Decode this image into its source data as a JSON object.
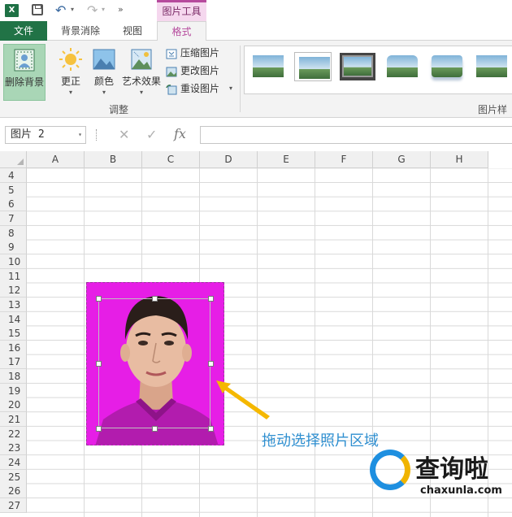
{
  "quick_access": {
    "app_icon": "X",
    "context_tools_label": "图片工具"
  },
  "tabs": {
    "file": "文件",
    "background_removal": "背景消除",
    "view": "视图",
    "format": "格式"
  },
  "ribbon": {
    "remove_background": "删除背景",
    "corrections": "更正",
    "color": "颜色",
    "artistic_effects": "艺术效果",
    "compress_pictures": "压缩图片",
    "change_picture": "更改图片",
    "reset_picture": "重设图片",
    "adjust_group_label": "调整",
    "picture_styles_label": "图片样"
  },
  "formula_bar": {
    "name_box": "图片 2",
    "cancel_symbol": "✕",
    "enter_symbol": "✓",
    "fx_symbol": "fx",
    "formula_value": ""
  },
  "sheet": {
    "columns": [
      "A",
      "B",
      "C",
      "D",
      "E",
      "F",
      "G",
      "H"
    ],
    "rows": [
      "4",
      "5",
      "6",
      "7",
      "8",
      "9",
      "10",
      "11",
      "12",
      "13",
      "14",
      "15",
      "16",
      "17",
      "18",
      "19",
      "20",
      "21",
      "22",
      "23",
      "24",
      "25",
      "26",
      "27"
    ]
  },
  "annotation": {
    "text": "拖动选择照片区域"
  },
  "watermark": {
    "text": "查询啦",
    "url": "chaxunla.com"
  },
  "colors": {
    "excel_green": "#217346",
    "format_tab_accent": "#b64a9d",
    "photo_background": "#e61ee6",
    "annotation_blue": "#2f8fd0",
    "arrow_yellow": "#f5b800"
  }
}
